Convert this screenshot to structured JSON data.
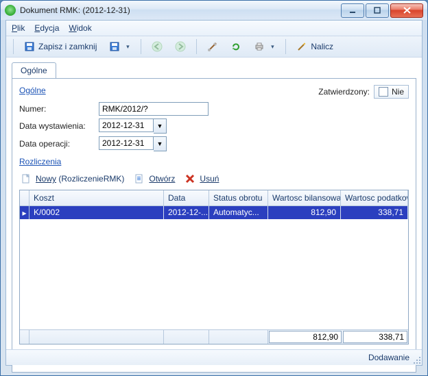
{
  "window": {
    "title": "Dokument RMK:  (2012-12-31)"
  },
  "menu": {
    "plik": "Plik",
    "edycja": "Edycja",
    "widok": "Widok"
  },
  "toolbar": {
    "zapisz_i_zamknij": "Zapisz i zamknij",
    "nalicz": "Nalicz"
  },
  "tabs": {
    "ogolne": "Ogólne"
  },
  "general": {
    "section": "Ogólne",
    "zatwierdzony_label": "Zatwierdzony:",
    "zatwierdzony_value": "Nie",
    "numer_label": "Numer:",
    "numer_value": "RMK/2012/?",
    "data_wystawienia_label": "Data wystawienia:",
    "data_wystawienia_value": "2012-12-31",
    "data_operacji_label": "Data operacji:",
    "data_operacji_value": "2012-12-31"
  },
  "rozliczenia": {
    "section": "Rozliczenia",
    "nowy_label": "Nowy",
    "nowy_hint": "(RozliczenieRMK)",
    "otworz": "Otwórz",
    "usun": "Usuń",
    "columns": {
      "koszt": "Koszt",
      "data": "Data",
      "status": "Status obrotu",
      "bilansowa": "Wartosc bilansowa",
      "podatkowa": "Wartosc podatkowa"
    },
    "rows": [
      {
        "koszt": "K/0002",
        "data": "2012-12-...",
        "status": "Automatyc...",
        "bilansowa": "812,90",
        "podatkowa": "338,71"
      }
    ],
    "totals": {
      "bilansowa": "812,90",
      "podatkowa": "338,71"
    }
  },
  "status": "Dodawanie"
}
